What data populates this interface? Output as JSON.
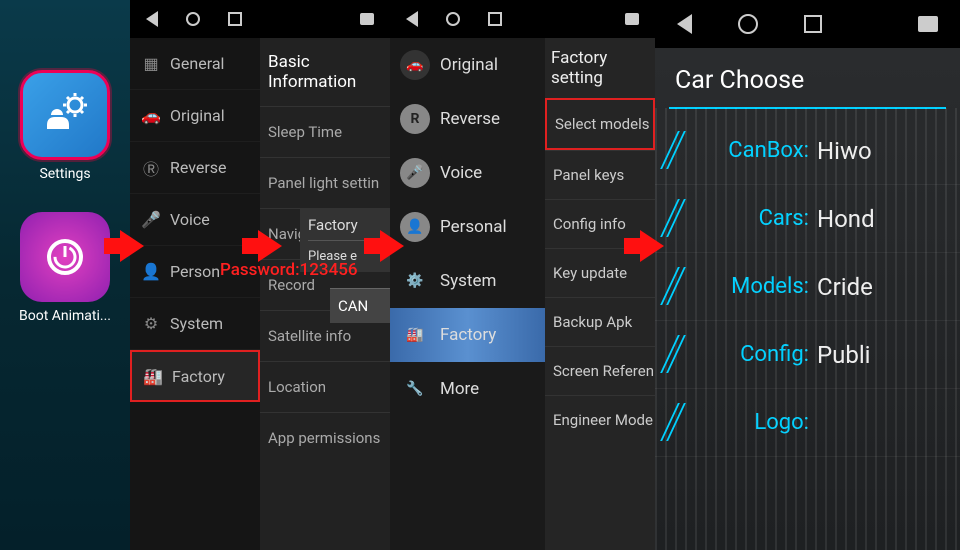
{
  "home": {
    "settings_label": "Settings",
    "boot_label": "Boot Animati..."
  },
  "password_overlay": "Password:123456",
  "panel2": {
    "nav": [
      "back",
      "home",
      "recent",
      "gallery"
    ],
    "menu": {
      "general": "General",
      "original": "Original",
      "reverse": "Reverse",
      "voice": "Voice",
      "personal": "Person",
      "system": "System",
      "factory": "Factory"
    },
    "info_header": "Basic Information",
    "rows": {
      "sleep": "Sleep Time",
      "panel": "Panel light settin",
      "nav": "Naviga",
      "record": "Record",
      "sat": "Satellite info",
      "loc": "Location",
      "perm": "App permissions"
    },
    "dialog": {
      "title": "Factory",
      "prompt": "Please e",
      "cancel": "CAN"
    }
  },
  "panel3": {
    "menu": {
      "original": "Original",
      "reverse": "Reverse",
      "voice": "Voice",
      "personal": "Personal",
      "system": "System",
      "factory": "Factory",
      "more": "More"
    },
    "header": "Factory setting",
    "rows": {
      "select_models": "Select models",
      "panel_keys": "Panel keys",
      "config_info": "Config info",
      "key_update": "Key update",
      "backup_apk": "Backup Apk",
      "screen_ref": "Screen Referen",
      "engineer": "Engineer Mode"
    }
  },
  "panel4": {
    "title": "Car Choose",
    "rows": [
      {
        "label": "CanBox:",
        "value": "Hiwo"
      },
      {
        "label": "Cars:",
        "value": "Hond"
      },
      {
        "label": "Models:",
        "value": "Cride"
      },
      {
        "label": "Config:",
        "value": "Publi"
      },
      {
        "label": "Logo:",
        "value": ""
      }
    ]
  }
}
